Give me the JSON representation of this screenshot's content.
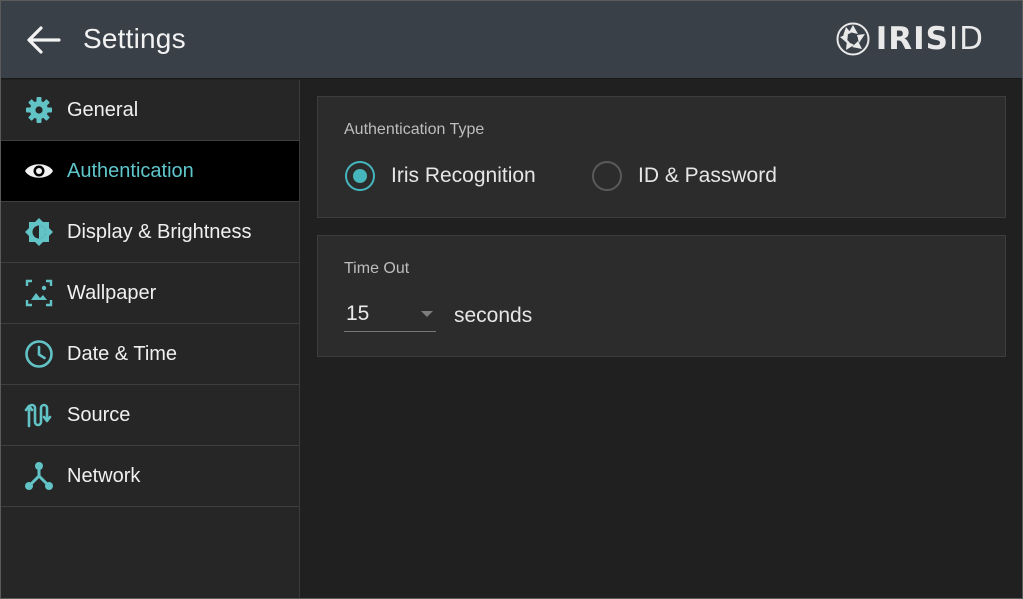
{
  "header": {
    "title": "Settings",
    "back_icon": "arrow-left-icon",
    "logo": {
      "text_bold": "IRIS",
      "text_light": "ID",
      "icon": "iris-aperture-icon"
    }
  },
  "sidebar": {
    "items": [
      {
        "label": "General",
        "icon": "gear-icon",
        "active": false
      },
      {
        "label": "Authentication",
        "icon": "eye-icon",
        "active": true
      },
      {
        "label": "Display & Brightness",
        "icon": "brightness-icon",
        "active": false
      },
      {
        "label": "Wallpaper",
        "icon": "wallpaper-icon",
        "active": false
      },
      {
        "label": "Date & Time",
        "icon": "clock-icon",
        "active": false
      },
      {
        "label": "Source",
        "icon": "source-icon",
        "active": false
      },
      {
        "label": "Network",
        "icon": "network-icon",
        "active": false
      }
    ]
  },
  "main": {
    "authentication": {
      "title": "Authentication Type",
      "options": [
        {
          "label": "Iris Recognition",
          "selected": true
        },
        {
          "label": "ID & Password",
          "selected": false
        }
      ]
    },
    "timeout": {
      "title": "Time Out",
      "value": "15",
      "unit": "seconds"
    }
  },
  "colors": {
    "accent": "#45b6bc",
    "accent_text": "#5fc7cb",
    "header_bg": "#394048",
    "sidebar_bg": "#262626",
    "card_bg": "#2c2c2c",
    "icon": "#62c3c6"
  }
}
